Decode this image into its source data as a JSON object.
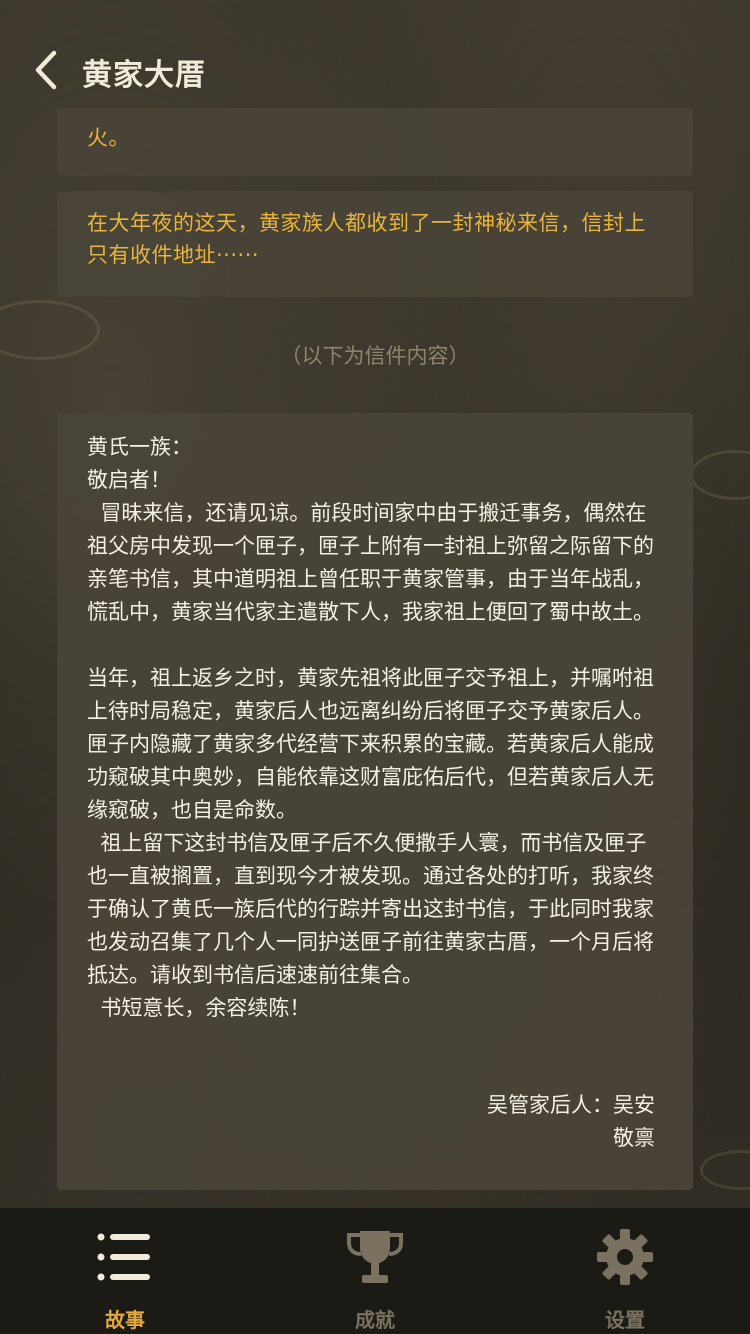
{
  "header": {
    "title": "黄家大厝",
    "back_icon": "chevron-left-icon"
  },
  "story": {
    "card1_text": "火。",
    "card2_text": "在大年夜的这天，黄家族人都收到了一封神秘来信，信封上只有收件地址······",
    "divider": "（以下为信件内容）"
  },
  "letter": {
    "salutation": "黄氏一族：",
    "greeting": "敬启者！",
    "para1": "  冒昧来信，还请见谅。前段时间家中由于搬迁事务，偶然在祖父房中发现一个匣子，匣子上附有一封祖上弥留之际留下的亲笔书信，其中道明祖上曾任职于黄家管事，由于当年战乱，慌乱中，黄家当代家主遣散下人，我家祖上便回了蜀中故土。",
    "para2": "当年，祖上返乡之时，黄家先祖将此匣子交予祖上，并嘱咐祖上待时局稳定，黄家后人也远离纠纷后将匣子交予黄家后人。匣子内隐藏了黄家多代经营下来积累的宝藏。若黄家后人能成功窥破其中奥妙，自能依靠这财富庇佑后代，但若黄家后人无缘窥破，也自是命数。",
    "para3": "  祖上留下这封书信及匣子后不久便撒手人寰，而书信及匣子也一直被搁置，直到现今才被发现。通过各处的打听，我家终于确认了黄氏一族后代的行踪并寄出这封书信，于此同时我家也发动召集了几个人一同护送匣子前往黄家古厝，一个月后将抵达。请收到书信后速速前往集合。",
    "closing": "  书短意长，余容续陈！",
    "signature": "吴管家后人：吴安",
    "signoff": "敬禀"
  },
  "nav": {
    "items": [
      {
        "label": "故事",
        "icon": "list-icon",
        "active": true
      },
      {
        "label": "成就",
        "icon": "trophy-icon",
        "active": false
      },
      {
        "label": "设置",
        "icon": "gear-icon",
        "active": false
      }
    ]
  },
  "colors": {
    "accent": "#e2a93a",
    "gold_text": "#e8b53a",
    "inactive": "#7a7160",
    "nav_bg": "#1c1a15"
  }
}
